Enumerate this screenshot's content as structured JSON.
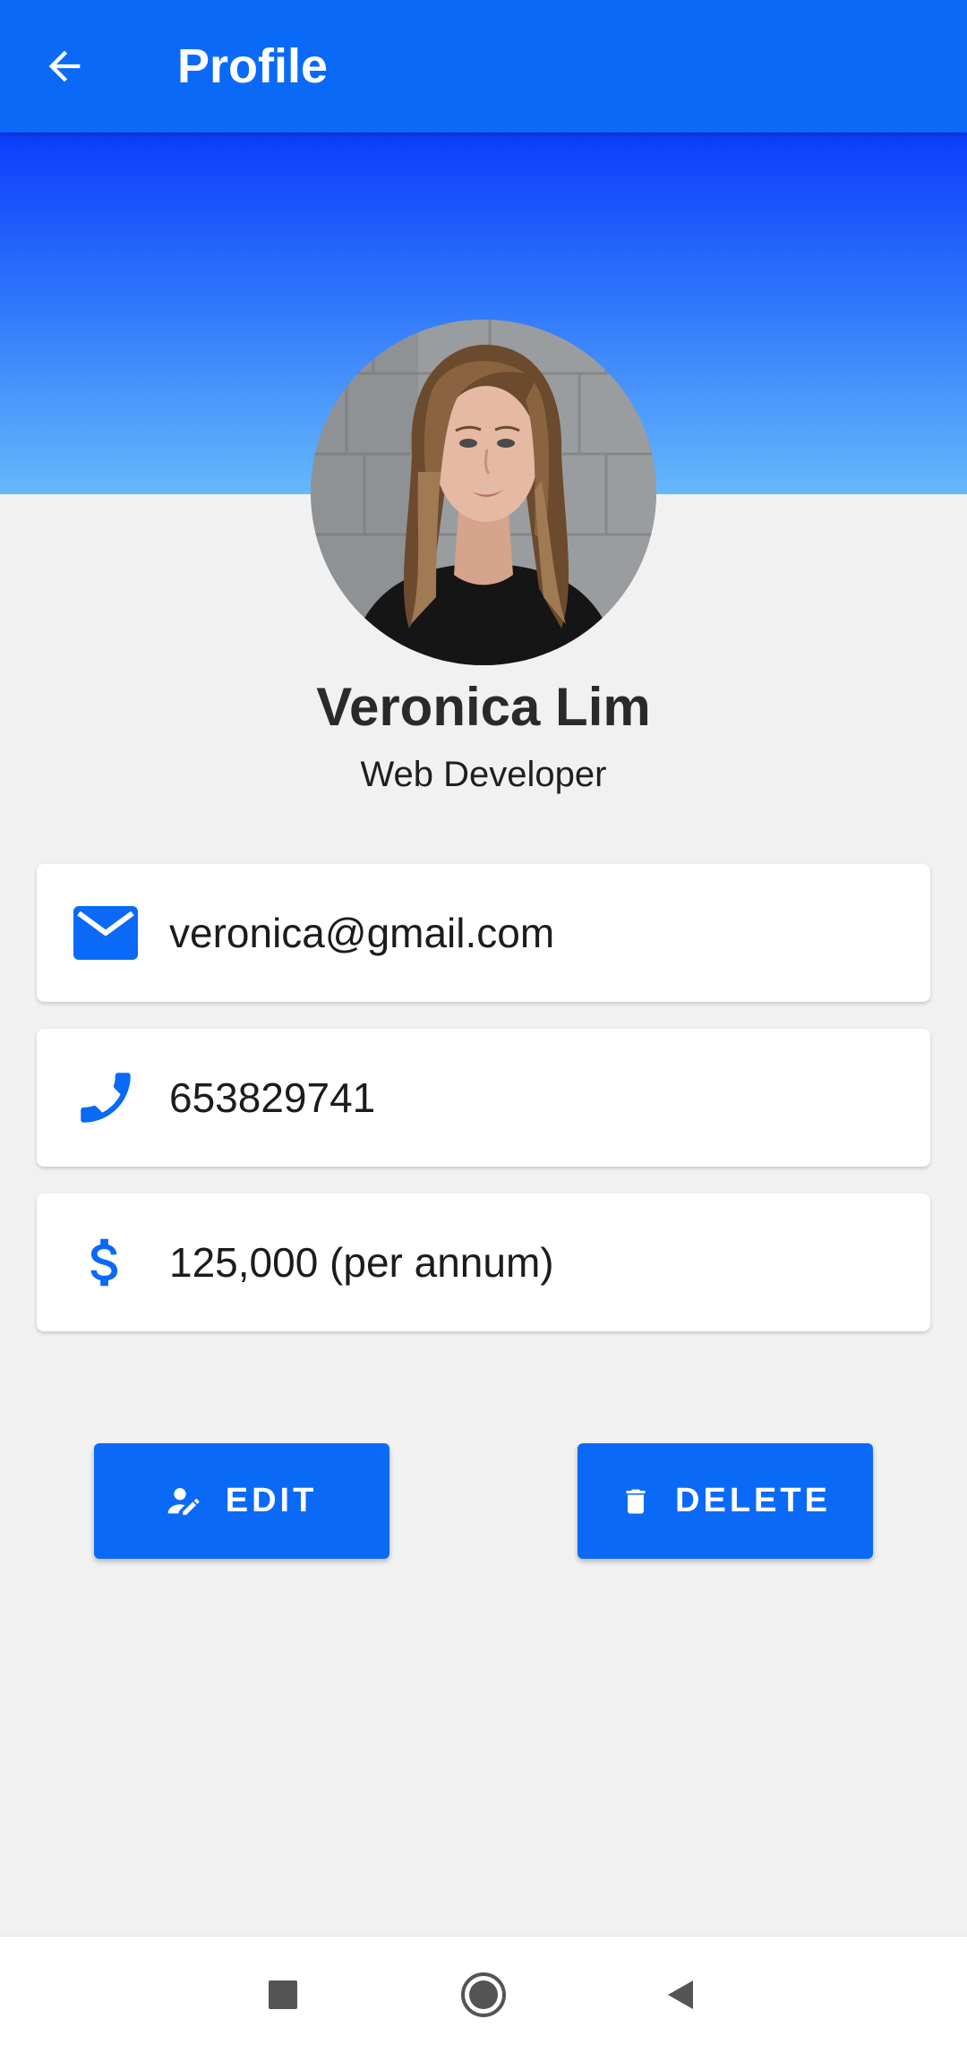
{
  "app_bar": {
    "title": "Profile",
    "back_icon": "arrow-left-icon"
  },
  "profile": {
    "name": "Veronica Lim",
    "role": "Web Developer"
  },
  "details": {
    "email": "veronica@gmail.com",
    "phone": "653829741",
    "salary": "125,000 (per annum)"
  },
  "actions": {
    "edit_label": "EDIT",
    "delete_label": "DELETE"
  },
  "nav": {
    "recents_icon": "square-icon",
    "home_icon": "circle-home-icon",
    "back_icon": "triangle-back-icon"
  },
  "colors": {
    "primary": "#0a6af7",
    "background": "#f1f1f1",
    "gradient_top": "#0b3cfb",
    "gradient_bottom": "#66b8fb"
  }
}
